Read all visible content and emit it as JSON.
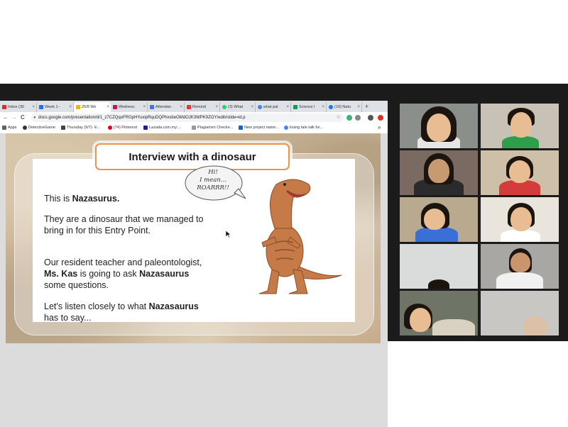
{
  "browser": {
    "tabs": [
      {
        "label": "Inbox (30",
        "color": "#d93025"
      },
      {
        "label": "Week 1 -",
        "color": "#1a73e8"
      },
      {
        "label": "25/8 We",
        "color": "#f4b400"
      },
      {
        "label": "Wednesc",
        "color": "#c2185b"
      },
      {
        "label": "Attendan",
        "color": "#4a6cf7"
      },
      {
        "label": "Remind",
        "color": "#e53935"
      },
      {
        "label": "(3) What",
        "color": "#25d366"
      },
      {
        "label": "what pal",
        "color": "#4285f4"
      },
      {
        "label": "Science l",
        "color": "#0f9d58"
      },
      {
        "label": "(19) Natu",
        "color": "#1877f2"
      }
    ],
    "new_tab": "+",
    "back": "←",
    "forward": "→",
    "reload": "C",
    "url": "docs.google.com/presentation/d/1_z7CZQqoFRGpHYuxipRquDQPhxsbeOMdOJK3WPK9ZOY/edit#slide=id.p",
    "bookmarks": [
      {
        "label": "Apps"
      },
      {
        "label": "DetectiveGame"
      },
      {
        "label": "Thursday (9/7)- E..."
      },
      {
        "label": "(74) Pinterest"
      },
      {
        "label": "Lazada.com.my:..."
      },
      {
        "label": "Plagiarism Checke..."
      },
      {
        "label": "New project name..."
      },
      {
        "label": "losing tale talk for..."
      }
    ],
    "bookmarks_more": "»"
  },
  "slide": {
    "title": "Interview with a dinosaur",
    "para1_prefix": "This is ",
    "para1_name": "Nazasurus.",
    "para2": "They are a dinosaur that we managed to bring in for this Entry Point.",
    "para3_prefix": "Our resident teacher and paleontologist, ",
    "para3_name": "Ms. Kas",
    "para3_mid": " is going to ask ",
    "para3_name2": "Nazasaurus",
    "para3_suffix": " some questions.",
    "para4_prefix": "Let's listen closely to what ",
    "para4_name": "Nazasaurus",
    "para4_suffix": " has to say...",
    "bubble_line1": "Hi!",
    "bubble_line2": "I mean...",
    "bubble_line3": "ROARRR!!"
  }
}
